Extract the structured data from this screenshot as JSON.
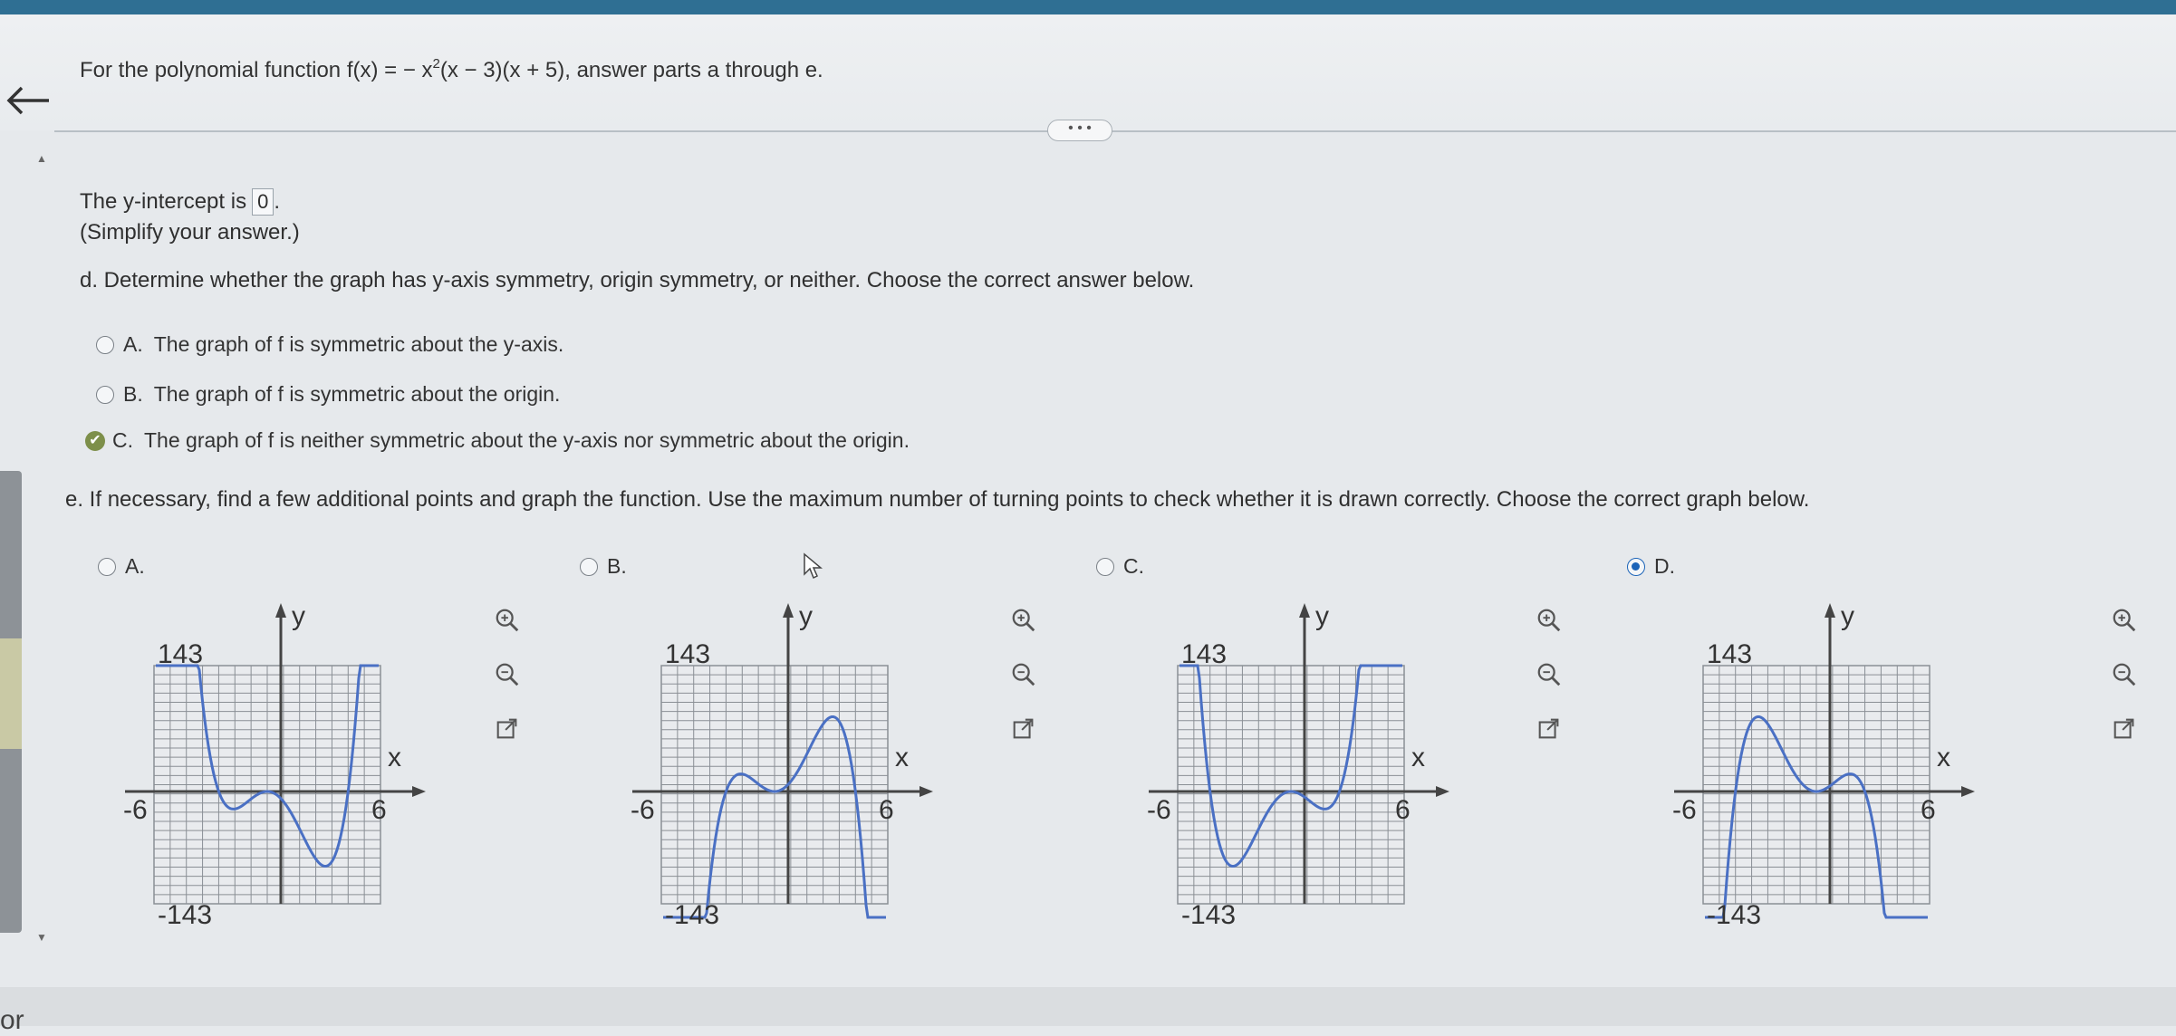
{
  "header": {
    "prompt_prefix": "For the polynomial function",
    "function_pre": "f(x) = − x",
    "function_exp": "2",
    "function_post": "(x − 3)(x + 5)",
    "prompt_suffix": ", answer parts a through e.",
    "more_label": "• • •"
  },
  "part_c": {
    "label": "The y-intercept is",
    "value": "0",
    "end": ".",
    "hint": "(Simplify your answer.)"
  },
  "part_d": {
    "question": "d. Determine whether the graph has y-axis symmetry, origin symmetry, or neither. Choose the correct answer below.",
    "options": [
      {
        "letter": "A.",
        "text": "The graph of f is symmetric about the y-axis."
      },
      {
        "letter": "B.",
        "text": "The graph of f is symmetric about the origin."
      },
      {
        "letter": "C.",
        "text": "The graph of f is neither symmetric about the y-axis nor symmetric about the origin."
      }
    ],
    "selected": "C"
  },
  "part_e": {
    "question": "e. If necessary, find a few additional points and graph the function. Use the maximum number of turning points to check whether it is drawn correctly. Choose the correct graph below.",
    "graphs": [
      {
        "letter": "A."
      },
      {
        "letter": "B."
      },
      {
        "letter": "C."
      },
      {
        "letter": "D."
      }
    ],
    "selected": "D",
    "axis": {
      "y_label": "y",
      "x_label": "x",
      "y_max_label": "143",
      "y_min_label": "-143",
      "x_min_label": "-6",
      "x_max_label": "6"
    }
  },
  "colors": {
    "curve": "#4a70c4",
    "grid": "#8a8f95",
    "accent": "#1c64b8",
    "check": "#7d8f4a"
  },
  "icons": [
    "back-arrow-icon",
    "zoom-in-icon",
    "zoom-out-icon",
    "external-link-icon",
    "check-icon"
  ],
  "footer_fragment": "or"
}
